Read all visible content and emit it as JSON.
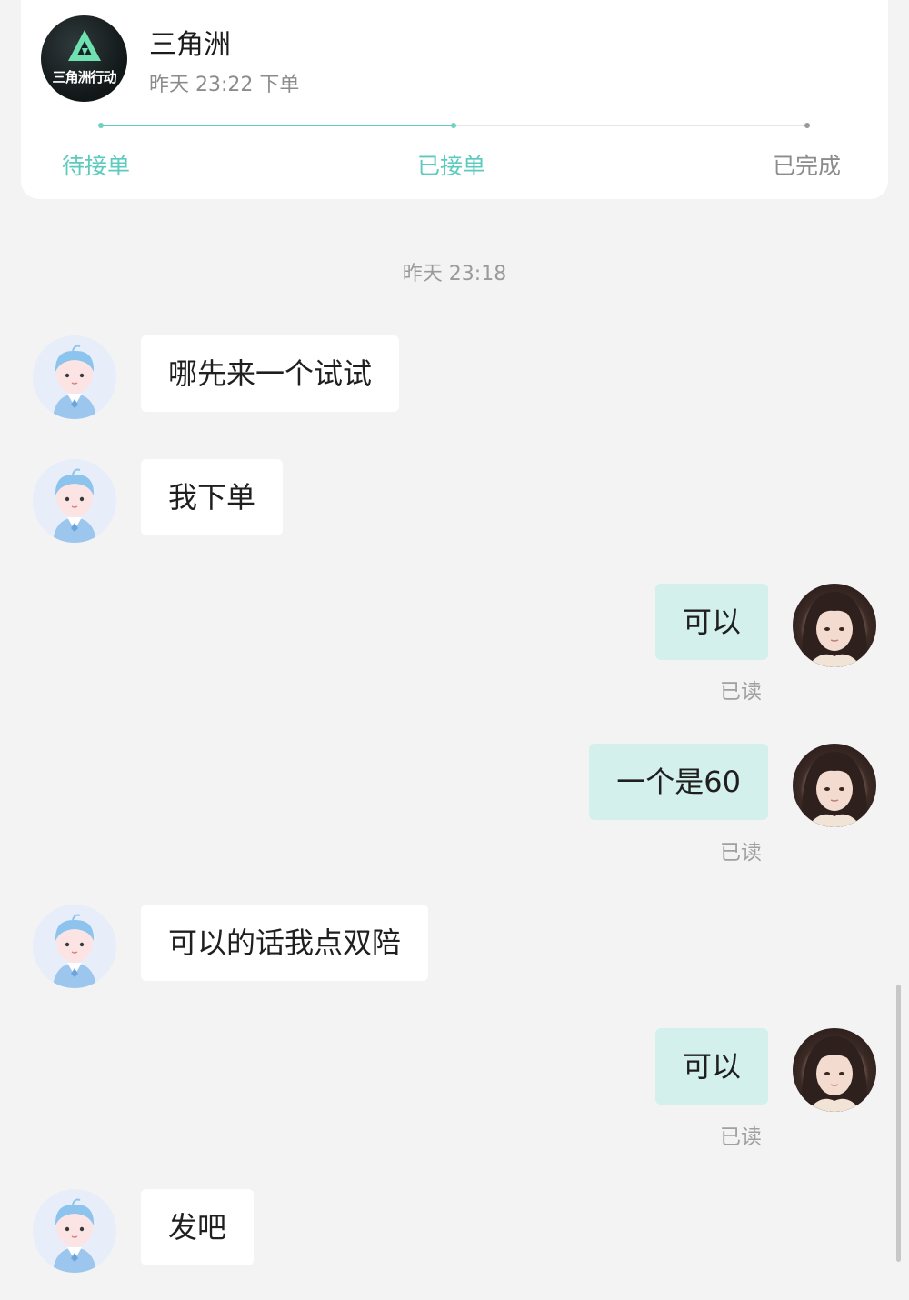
{
  "order": {
    "logo_icon": "delta-force-logo",
    "logo_text": "三角洲行动",
    "game_name": "三角洲",
    "order_time": "昨天 23:22 下单",
    "progress_fraction": 0.5,
    "accent_color": "#5ccbbd",
    "steps": [
      {
        "label": "待接单",
        "state": "done"
      },
      {
        "label": "已接单",
        "state": "current"
      },
      {
        "label": "已完成",
        "state": "pending"
      }
    ]
  },
  "chat": {
    "timestamp": "昨天 23:18",
    "messages": [
      {
        "from": "other",
        "avatar": "default-user-avatar",
        "text": "哪先来一个试试"
      },
      {
        "from": "other",
        "avatar": "default-user-avatar",
        "text": "我下单"
      },
      {
        "from": "self",
        "avatar": "profile-photo-avatar",
        "text": "可以",
        "status": "已读"
      },
      {
        "from": "self",
        "avatar": "profile-photo-avatar",
        "text": "一个是60",
        "status": "已读"
      },
      {
        "from": "other",
        "avatar": "default-user-avatar",
        "text": "可以的话我点双陪"
      },
      {
        "from": "self",
        "avatar": "profile-photo-avatar",
        "text": "可以",
        "status": "已读"
      },
      {
        "from": "other",
        "avatar": "default-user-avatar",
        "text": "发吧"
      }
    ]
  }
}
